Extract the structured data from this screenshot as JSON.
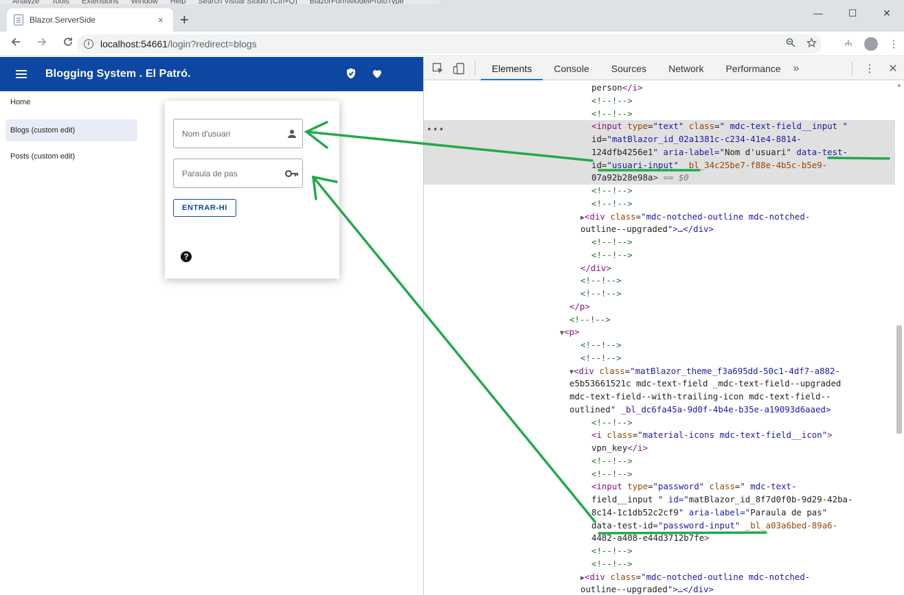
{
  "os_menu": [
    "Analyze",
    "Tools",
    "Extensions",
    "Window",
    "Help",
    "Search Visual Studio (Ctrl+Q)",
    "BlazorFormModelProtoType"
  ],
  "browser": {
    "tab_title": "Blazor.ServerSide",
    "tab_close": "×",
    "new_tab": "+",
    "url_host": "localhost:54661",
    "url_path": "/login?redirect=blogs",
    "window_min": "—",
    "window_max": "☐",
    "window_close": "✕"
  },
  "app": {
    "title": "Blogging System . El Patró.",
    "sidebar": [
      {
        "label": "Home"
      },
      {
        "label": "Blogs (custom edit)"
      },
      {
        "label": "Posts (custom edit)"
      }
    ],
    "login": {
      "username_placeholder": "Nom d'usuari",
      "password_placeholder": "Paraula de pas",
      "button": "ENTRAR-HI",
      "help": "?"
    }
  },
  "devtools": {
    "tabs": [
      "Elements",
      "Console",
      "Sources",
      "Network",
      "Performance"
    ],
    "active_tab": "Elements",
    "more_tabs": "»",
    "code_lines": [
      {
        "indent": 62,
        "t": "person</i>"
      },
      {
        "indent": 62,
        "t": "<!--!-->"
      },
      {
        "indent": 62,
        "t": "<!--!-->"
      },
      {
        "indent": 62,
        "t": "<input type=\"text\" class=\" mdc-text-field__input \"",
        "sel": true
      },
      {
        "indent": 62,
        "t": "id=\"matBlazor_id_02a1381c-c234-41e4-8814-",
        "sel": true
      },
      {
        "indent": 62,
        "t": "124dfb4256e1\" aria-label=\"Nom d'usuari\" data-test-",
        "sel": true
      },
      {
        "indent": 62,
        "t": "id=\"usuari-input\" _bl_34c25be7-f88e-4b5c-b5e9-",
        "sel": true
      },
      {
        "indent": 62,
        "t": "07a92b28e98a> == $0",
        "sel": true
      },
      {
        "indent": 62,
        "t": "<!--!-->"
      },
      {
        "indent": 62,
        "t": "<!--!-->"
      },
      {
        "indent": 46,
        "t": "▶<div class=\"mdc-notched-outline mdc-notched-"
      },
      {
        "indent": 46,
        "t": "outline--upgraded\">…</div>"
      },
      {
        "indent": 62,
        "t": "<!--!-->"
      },
      {
        "indent": 62,
        "t": "<!--!-->"
      },
      {
        "indent": 46,
        "t": "</div>"
      },
      {
        "indent": 46,
        "t": "<!--!-->"
      },
      {
        "indent": 46,
        "t": "<!--!-->"
      },
      {
        "indent": 30,
        "t": "</p>"
      },
      {
        "indent": 30,
        "t": "<!--!-->"
      },
      {
        "indent": 16,
        "t": "▼<p>"
      },
      {
        "indent": 46,
        "t": "<!--!-->"
      },
      {
        "indent": 46,
        "t": "<!--!-->"
      },
      {
        "indent": 30,
        "t": "▼<div class=\"matBlazor_theme_f3a695dd-50c1-4df7-a882-"
      },
      {
        "indent": 30,
        "t": "e5b53661521c mdc-text-field _mdc-text-field--upgraded"
      },
      {
        "indent": 30,
        "t": "mdc-text-field--with-trailing-icon mdc-text-field--"
      },
      {
        "indent": 30,
        "t": "outlined\" _bl_dc6fa45a-9d0f-4b4e-b35e-a19093d6aaed>"
      },
      {
        "indent": 62,
        "t": "<!--!-->"
      },
      {
        "indent": 62,
        "t": "<i class=\"material-icons mdc-text-field__icon\">"
      },
      {
        "indent": 62,
        "t": "vpn_key</i>"
      },
      {
        "indent": 62,
        "t": "<!--!-->"
      },
      {
        "indent": 62,
        "t": "<!--!-->"
      },
      {
        "indent": 62,
        "t": "<input type=\"password\" class=\" mdc-text-"
      },
      {
        "indent": 62,
        "t": "field__input \" id=\"matBlazor_id_8f7d0f0b-9d29-42ba-"
      },
      {
        "indent": 62,
        "t": "8c14-1c1db52c2cf9\" aria-label=\"Paraula de pas\""
      },
      {
        "indent": 62,
        "t": "data-test-id=\"password-input\" _bl_a03a6bed-89a6-"
      },
      {
        "indent": 62,
        "t": "4482-a408-e44d3712b7fe>"
      },
      {
        "indent": 62,
        "t": "<!--!-->"
      },
      {
        "indent": 62,
        "t": "<!--!-->"
      },
      {
        "indent": 46,
        "t": "▶<div class=\"mdc-notched-outline mdc-notched-"
      },
      {
        "indent": 46,
        "t": "outline--upgraded\">…</div>"
      }
    ],
    "ellipsis": "•••"
  },
  "colors": {
    "appbar": "#0d47a1",
    "annotation": "#22a94a"
  }
}
